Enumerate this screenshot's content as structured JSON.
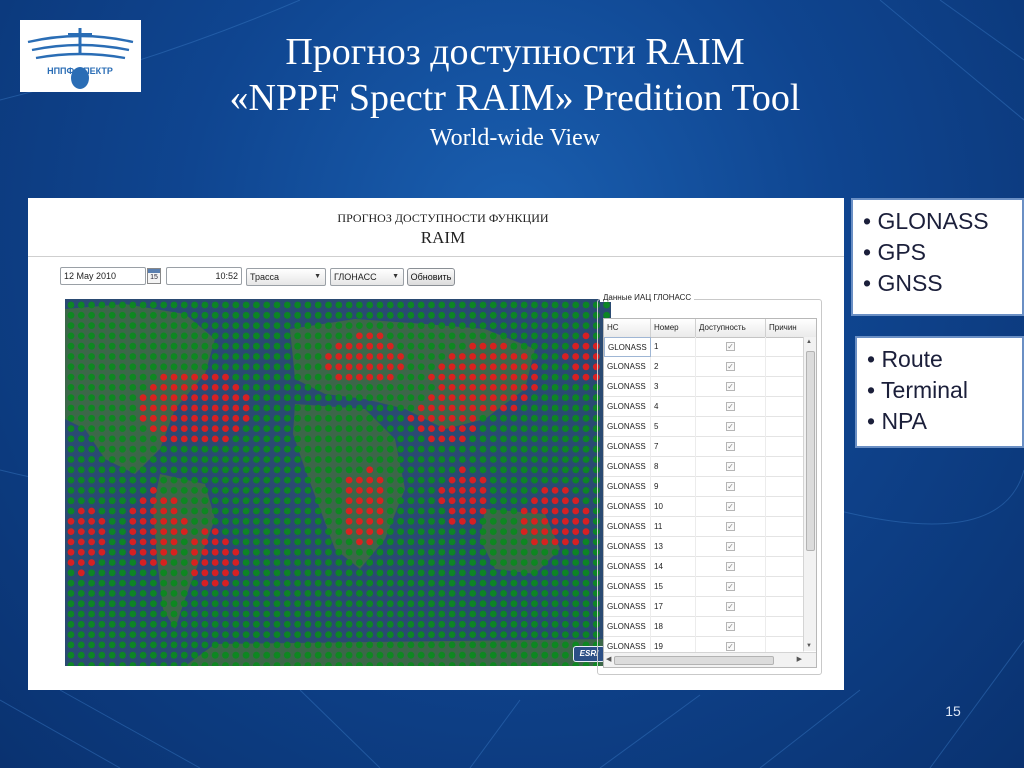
{
  "slide": {
    "title_line1": "Прогноз доступности RAIM",
    "title_line2": "«NPPF Spectr RAIM» Predition Tool",
    "title_line3": "World-wide View",
    "page_number": "15"
  },
  "logo": {
    "text": "НППФ СПЕКТР",
    "colors": {
      "primary": "#2a6db5",
      "background": "#ffffff"
    }
  },
  "app": {
    "title_small": "ПРОГНОЗ ДОСТУПНОСТИ ФУНКЦИИ",
    "title_big": "RAIM",
    "toolbar": {
      "date_value": "12 May 2010",
      "calendar_day": "15",
      "time_value": "10:52",
      "phase_select": "Трасса",
      "system_select": "ГЛОНАСС",
      "update_button": "Обновить"
    },
    "map": {
      "attribution": "ESRI",
      "colors": {
        "available": "#0b8a1e",
        "unavailable": "#e51c1c",
        "ocean": "#29476e"
      }
    },
    "panel": {
      "group_title": "Данные ИАЦ ГЛОНАСС",
      "columns": [
        "НС",
        "Номер",
        "Доступность",
        "Причин"
      ],
      "rows": [
        {
          "ns": "GLONASS",
          "num": "1",
          "avail": true
        },
        {
          "ns": "GLONASS",
          "num": "2",
          "avail": true
        },
        {
          "ns": "GLONASS",
          "num": "3",
          "avail": true
        },
        {
          "ns": "GLONASS",
          "num": "4",
          "avail": true
        },
        {
          "ns": "GLONASS",
          "num": "5",
          "avail": true
        },
        {
          "ns": "GLONASS",
          "num": "7",
          "avail": true
        },
        {
          "ns": "GLONASS",
          "num": "8",
          "avail": true
        },
        {
          "ns": "GLONASS",
          "num": "9",
          "avail": true
        },
        {
          "ns": "GLONASS",
          "num": "10",
          "avail": true
        },
        {
          "ns": "GLONASS",
          "num": "11",
          "avail": true
        },
        {
          "ns": "GLONASS",
          "num": "13",
          "avail": true
        },
        {
          "ns": "GLONASS",
          "num": "14",
          "avail": true
        },
        {
          "ns": "GLONASS",
          "num": "15",
          "avail": true
        },
        {
          "ns": "GLONASS",
          "num": "17",
          "avail": true
        },
        {
          "ns": "GLONASS",
          "num": "18",
          "avail": true
        },
        {
          "ns": "GLONASS",
          "num": "19",
          "avail": true
        }
      ]
    }
  },
  "bullets_systems": [
    "• GLONASS",
    "• GPS",
    "• GNSS"
  ],
  "bullets_phases": [
    "• Route",
    "• Terminal",
    "• NPA"
  ]
}
